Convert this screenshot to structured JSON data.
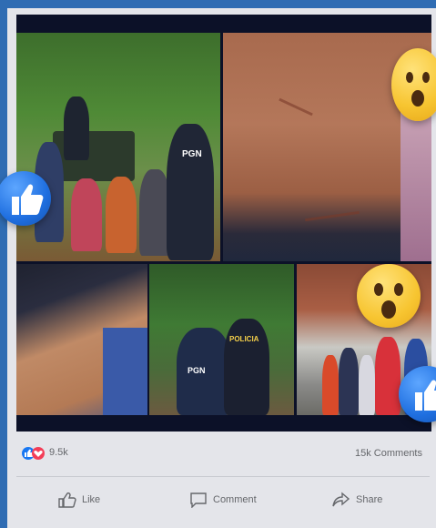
{
  "post": {
    "photos": [
      {
        "name": "photo-police-with-children",
        "badge": "PGN"
      },
      {
        "name": "photo-injured-back"
      },
      {
        "name": "photo-injured-arm"
      },
      {
        "name": "photo-officers-in-forest",
        "badge": "POLICIA",
        "badge2": "PGN"
      },
      {
        "name": "photo-family-at-house"
      }
    ],
    "reactions": {
      "count": "9.5k",
      "comments": "15k Comments"
    },
    "actions": {
      "like": "Like",
      "comment": "Comment",
      "share": "Share"
    }
  },
  "colors": {
    "accent": "#1877f2",
    "love": "#f33e58",
    "frame": "#2f6cb3"
  }
}
